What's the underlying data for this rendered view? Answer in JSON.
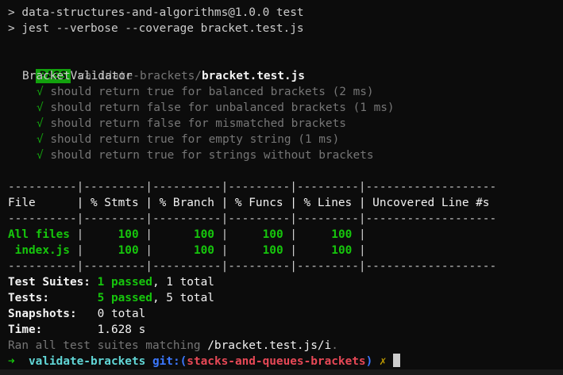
{
  "colors": {
    "background": "#0c0c0c",
    "text": "#cccccc",
    "pass_badge_bg": "#13a10e",
    "green": "#13a10e",
    "bright_green": "#16c60c",
    "dim": "#767676",
    "prompt_arrow": "#16c60c",
    "directory": "#61d6d6",
    "git_label": "#3b78ff",
    "branch": "#e74856",
    "dirty_mark": "#c19c00"
  },
  "header": {
    "line1": "> data-structures-and-algorithms@1.0.0 test",
    "line2": "> jest --verbose --coverage bracket.test.js"
  },
  "result": {
    "badge": "PASS",
    "path_dir": "validate-brackets/",
    "path_file": "bracket.test.js"
  },
  "suite": {
    "name": "BracketValidator",
    "check_icon": "check-mark-icon",
    "check_glyph": "√",
    "tests": [
      {
        "text": "should return true for balanced brackets",
        "time": "(2 ms)"
      },
      {
        "text": "should return false for unbalanced brackets",
        "time": "(1 ms)"
      },
      {
        "text": "should return false for mismatched brackets",
        "time": ""
      },
      {
        "text": "should return true for empty string",
        "time": "(1 ms)"
      },
      {
        "text": "should return true for strings without brackets",
        "time": ""
      }
    ]
  },
  "coverage": {
    "separator": "----------|---------|----------|---------|---------|-------------------",
    "header": "File      | % Stmts | % Branch | % Funcs | % Lines | Uncovered Line #s ",
    "rows": [
      {
        "file": "All files",
        "stmts": "100",
        "branch": "100",
        "funcs": "100",
        "lines": "100",
        "uncovered": ""
      },
      {
        "file": " index.js",
        "stmts": "100",
        "branch": "100",
        "funcs": "100",
        "lines": "100",
        "uncovered": ""
      }
    ]
  },
  "summary": {
    "suites_label": "Test Suites:",
    "suites_passed": "1 passed",
    "suites_total": ", 1 total",
    "tests_label": "Tests:",
    "tests_passed": "5 passed",
    "tests_total": ", 5 total",
    "snapshots_label": "Snapshots:",
    "snapshots_value": "0 total",
    "time_label": "Time:",
    "time_value": "1.628 s",
    "ran_prefix": "Ran all test suites matching ",
    "ran_pattern": "/bracket.test.js/i",
    "ran_suffix": "."
  },
  "prompt": {
    "arrow": "➜",
    "directory": "validate-brackets",
    "git_label": "git:(",
    "branch": "stacks-and-queues-brackets",
    "git_close": ")",
    "dirty_mark": "✗"
  }
}
